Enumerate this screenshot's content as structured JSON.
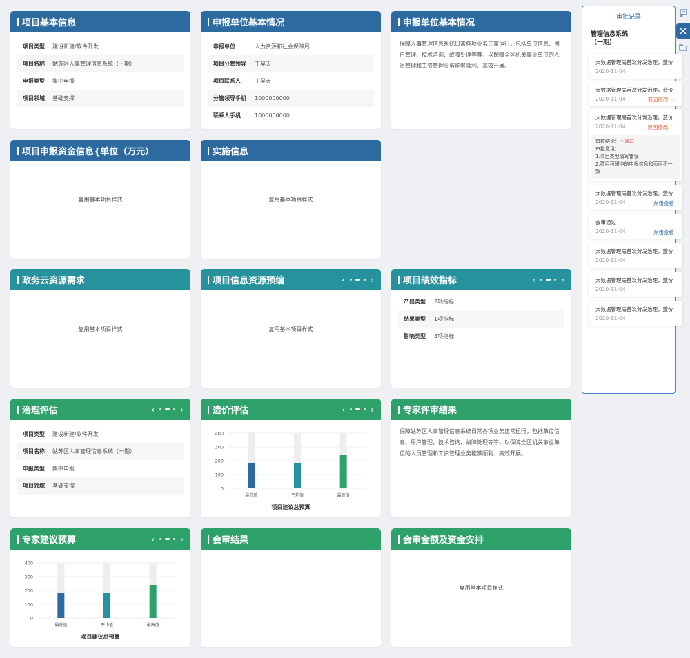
{
  "colors": {
    "blue": "#2c6aa0",
    "teal": "#26929e",
    "green": "#2ea16b"
  },
  "cards": {
    "basic": {
      "title": "项目基本信息",
      "rows": [
        {
          "k": "项目类型",
          "v": "建设新建/软件开发"
        },
        {
          "k": "项目名称",
          "v": "姑苏区人事管理信息系统（一期）"
        },
        {
          "k": "申报类型",
          "v": "集中申报"
        },
        {
          "k": "项目领域",
          "v": "基础支撑"
        }
      ]
    },
    "unit": {
      "title": "申报单位基本情况",
      "rows": [
        {
          "k": "申报单位",
          "v": "人力资源和社会保障局"
        },
        {
          "k": "项目分管领导",
          "v": "丁昊天"
        },
        {
          "k": "项目联系人",
          "v": "丁昊天"
        },
        {
          "k": "分管领导手机",
          "v": "1000000000"
        },
        {
          "k": "联系人手机",
          "v": "1000000000"
        }
      ]
    },
    "unit2": {
      "title": "申报单位基本情况",
      "text": "保障人事管理信息系统日常各项业务正常运行，包括单位信息、用户管理、技术咨询、故障处理等等，以保障全区机关事业单位的人员管理和工资管理业务能够顺利、高效开展。"
    },
    "funds": {
      "title": "项目申报资金信息{单位（万元）",
      "placeholder": "复用基本项目样式"
    },
    "impl": {
      "title": "实施信息",
      "placeholder": "复用基本项目样式"
    },
    "cloud": {
      "title": "政务云资源需求",
      "placeholder": "复用基本项目样式"
    },
    "resource": {
      "title": "项目信息资源预编",
      "placeholder": "复用基本项目样式",
      "prev": "‹",
      "next": "›"
    },
    "perf": {
      "title": "项目绩效指标",
      "prev": "‹",
      "next": "›",
      "rows": [
        {
          "k": "产出类型",
          "v": "2项指标"
        },
        {
          "k": "结果类型",
          "v": "1项指标"
        },
        {
          "k": "影响类型",
          "v": "3项指标"
        }
      ]
    },
    "gov": {
      "title": "治理评估",
      "prev": "‹",
      "next": "›",
      "rows": [
        {
          "k": "项目类型",
          "v": "建设新建/软件开发"
        },
        {
          "k": "项目名称",
          "v": "姑苏区人事管理信息系统（一期）"
        },
        {
          "k": "申报类型",
          "v": "集中申报"
        },
        {
          "k": "项目领域",
          "v": "基础支撑"
        }
      ]
    },
    "cost": {
      "title": "造价评估",
      "prev": "‹",
      "next": "›"
    },
    "expert": {
      "title": "专家评审结果",
      "text": "保障姑苏区人事管理信息系统日常各项业务正常运行，包括单位信息、用户管理、技术咨询、故障处理等等，以保障全区机关事业单位的人员管理和工资管理业务能够顺利、高效开展。"
    },
    "budget": {
      "title": "专家建议预算",
      "prev": "‹",
      "next": "›"
    },
    "review": {
      "title": "会审结果"
    },
    "amount": {
      "title": "会审金额及资金安排",
      "placeholder": "复用基本项目样式"
    }
  },
  "chart_data": [
    {
      "type": "bar",
      "title": "项目建议总预算",
      "xlabel": "",
      "ylabel": "",
      "categories": [
        "最低值",
        "平均值",
        "最高值"
      ],
      "values": [
        180,
        180,
        240
      ],
      "ylim": [
        0,
        400
      ],
      "yticks": [
        0,
        100,
        200,
        300,
        400
      ],
      "colors": [
        "#2c6aa0",
        "#26929e",
        "#2ea16b"
      ]
    },
    {
      "type": "bar",
      "title": "项目建议总预算",
      "xlabel": "",
      "ylabel": "",
      "categories": [
        "最低值",
        "平均值",
        "最高值"
      ],
      "values": [
        180,
        180,
        240
      ],
      "ylim": [
        0,
        400
      ],
      "yticks": [
        0,
        100,
        200,
        300,
        400
      ],
      "colors": [
        "#2c6aa0",
        "#26929e",
        "#2ea16b"
      ]
    }
  ],
  "side": {
    "title": "审批记录",
    "project": "管理信息系统\n（一期）",
    "records": [
      {
        "text": "大数据管理局首次分发治理，造价",
        "date": "2020-11-04",
        "action": "",
        "chev": ""
      },
      {
        "text": "大数据管理局首次分发治理，造价",
        "date": "2020-11-04",
        "action": "退回修改",
        "chev": "⌄"
      },
      {
        "text": "大数据管理局首次分发治理，造价",
        "date": "2020-11-04",
        "action": "退回修改",
        "chev": "⌃",
        "detail": {
          "conclusion_label": "审核结论：",
          "conclusion": "不通过",
          "opinion_label": "审批意见：",
          "lines": [
            "1.项目类型填写错误",
            "2.项目可研中的申报信息和页面不一致"
          ]
        }
      },
      {
        "text": "大数据管理局首次分发治理，造价",
        "date": "2020-11-04",
        "action": "点击查看",
        "chev": ""
      },
      {
        "text": "会审通过",
        "date": "2020-11-04",
        "action": "点击查看",
        "chev": ""
      },
      {
        "text": "大数据管理局首次分发治理，造价",
        "date": "2020-11-04",
        "action": "",
        "chev": ""
      },
      {
        "text": "大数据管理局首次分发治理，造价",
        "date": "2020-11-04",
        "action": "",
        "chev": ""
      },
      {
        "text": "大数据管理局首次分发治理，造价",
        "date": "2020-11-04",
        "action": "",
        "chev": ""
      }
    ],
    "icons": [
      "comment-icon",
      "close-icon",
      "folder-icon"
    ]
  }
}
